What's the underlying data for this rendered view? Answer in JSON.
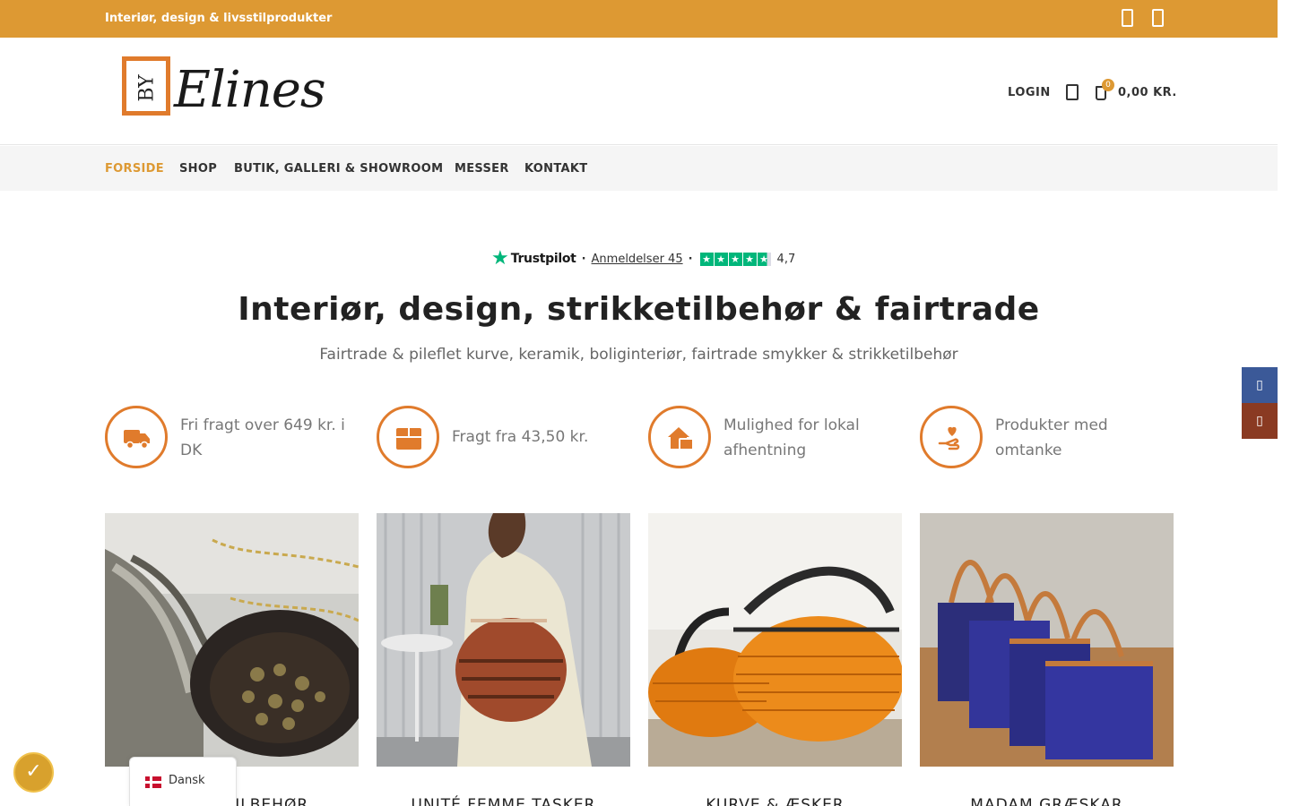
{
  "topbar": {
    "tagline": "Interiør, design & livsstilprodukter",
    "social_icons": [
      "facebook-icon",
      "instagram-icon"
    ]
  },
  "header": {
    "logo_by": "BY",
    "logo_word": "Elines",
    "login_label": "LOGIN",
    "cart_count": "0",
    "cart_total": "0,00 KR."
  },
  "nav": {
    "items": [
      "FORSIDE",
      "SHOP",
      "BUTIK, GALLERI & SHOWROOM",
      "MESSER",
      "KONTAKT"
    ],
    "active": "FORSIDE"
  },
  "trustpilot": {
    "brand": "Trustpilot",
    "reviews_label": "Anmeldelser 45",
    "rating": "4,7",
    "stars": 4.7
  },
  "hero": {
    "title": "Interiør, design, strikketilbehør & fairtrade",
    "subtitle": "Fairtrade & pileflet kurve, keramik, boliginteriør, fairtrade smykker & strikketilbehør"
  },
  "features": [
    {
      "icon": "truck-icon",
      "text": "Fri fragt over 649 kr. i DK"
    },
    {
      "icon": "box-icon",
      "text": "Fragt fra 43,50 kr."
    },
    {
      "icon": "house-pickup-icon",
      "text": "Mulighed for lokal afhentning"
    },
    {
      "icon": "hand-heart-icon",
      "text": "Produkter med omtanke"
    }
  ],
  "categories": [
    {
      "label": "STRIKKETILBEHØR",
      "image": "knitting-accessories-photo"
    },
    {
      "label": "UNITÉ FEMME TASKER",
      "image": "woven-bag-photo"
    },
    {
      "label": "KURVE & ÆSKER",
      "image": "baskets-photo"
    },
    {
      "label": "MADAM GRÆSKAR",
      "image": "grass-bags-photo"
    }
  ],
  "side_buttons": [
    "facebook-share-icon",
    "instagram-share-icon"
  ],
  "language": {
    "label": "Dansk"
  },
  "colors": {
    "accent": "#dd9933",
    "orange": "#e07b2c",
    "trustpilot_green": "#00b67a",
    "facebook": "#3b5998",
    "instagram": "#8a3a22"
  }
}
